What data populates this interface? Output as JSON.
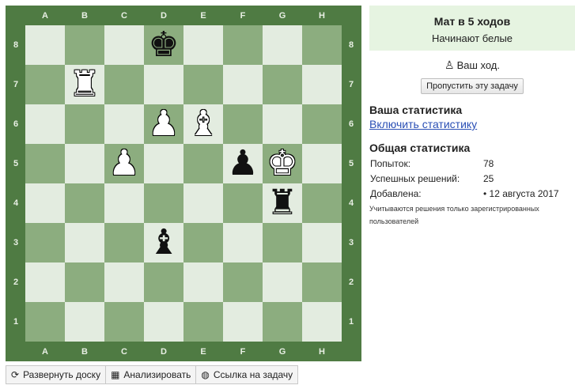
{
  "board": {
    "files": [
      "A",
      "B",
      "C",
      "D",
      "E",
      "F",
      "G",
      "H"
    ],
    "ranks": [
      "8",
      "7",
      "6",
      "5",
      "4",
      "3",
      "2",
      "1"
    ],
    "pieces": [
      {
        "square": "d8",
        "color": "black",
        "type": "king",
        "glyph": "♚"
      },
      {
        "square": "b7",
        "color": "white",
        "type": "rook",
        "glyph": "♜"
      },
      {
        "square": "d6",
        "color": "white",
        "type": "pawn",
        "glyph": "♟"
      },
      {
        "square": "e6",
        "color": "white",
        "type": "bishop",
        "glyph": "♝"
      },
      {
        "square": "c5",
        "color": "white",
        "type": "pawn",
        "glyph": "♟"
      },
      {
        "square": "f5",
        "color": "black",
        "type": "pawn",
        "glyph": "♟"
      },
      {
        "square": "g5",
        "color": "white",
        "type": "king",
        "glyph": "♚"
      },
      {
        "square": "g4",
        "color": "black",
        "type": "rook",
        "glyph": "♜"
      },
      {
        "square": "d3",
        "color": "black",
        "type": "bishop",
        "glyph": "♝"
      }
    ],
    "colors": {
      "light": "#e3ece0",
      "dark": "#8cad7f",
      "frame": "#4f7b43"
    }
  },
  "toolbar": {
    "expand": {
      "label": "Развернуть доску",
      "icon": "refresh-icon"
    },
    "analyze": {
      "label": "Анализировать",
      "icon": "grid-icon"
    },
    "link": {
      "label": "Ссылка на задачу",
      "icon": "globe-icon"
    }
  },
  "task": {
    "title": "Мат в 5 ходов",
    "subtitle": "Начинают белые",
    "turn": "Ваш ход.",
    "turn_icon": "pawn-icon",
    "skip": "Пропустить эту задачу",
    "box_color": "#e6f4e1"
  },
  "stats": {
    "heading": "Ваша статистика",
    "enable_link": "Включить статистику",
    "general_heading": "Общая статистика",
    "rows": [
      {
        "label": "Попыток:",
        "value": "78"
      },
      {
        "label": "Успешных решений:",
        "value": "25"
      },
      {
        "label": "Добавлена:",
        "value": "• 12 августа 2017"
      }
    ],
    "note": "Учитываются решения только зарегистрированных пользователей"
  }
}
